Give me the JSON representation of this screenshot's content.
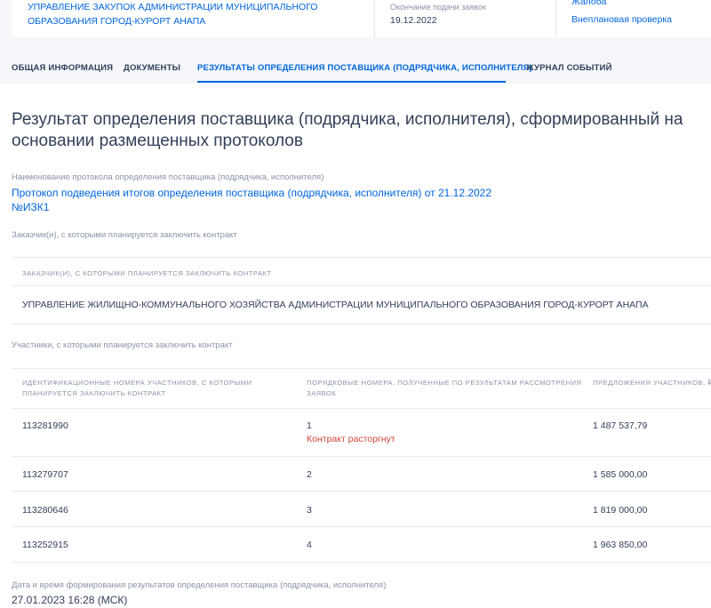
{
  "top": {
    "organizer": "УПРАВЛЕНИЕ ЗАКУПОК АДМИНИСТРАЦИИ МУНИЦИПАЛЬНОГО ОБРАЗОВАНИЯ ГОРОД-КУРОРТ АНАПА",
    "deadline_label": "Окончание подачи заявок",
    "deadline_value": "19.12.2022",
    "link1": "Жалоба",
    "link2": "Внеплановая проверка"
  },
  "tabs": [
    {
      "label": "ОБЩАЯ ИНФОРМАЦИЯ",
      "active": false
    },
    {
      "label": "ДОКУМЕНТЫ",
      "active": false
    },
    {
      "label": "РЕЗУЛЬТАТЫ ОПРЕДЕЛЕНИЯ ПОСТАВЩИКА (ПОДРЯДЧИКА, ИСПОЛНИТЕЛЯ)",
      "active": true
    },
    {
      "label": "ЖУРНАЛ СОБЫТИЙ",
      "active": false
    }
  ],
  "main": {
    "title": "Результат определения поставщика (подрядчика, исполнителя), сформированный на основании размещенных протоколов",
    "protocol_label": "Наименование протокола определения поставщика (подрядчика, исполнителя)",
    "protocol_link": "Протокол подведения итогов определения поставщика (подрядчика, исполнителя) от 21.12.2022 №ИЗК1",
    "customers_label": "Заказчик(и), с которыми планируется заключить контракт",
    "customers_table": {
      "header": "Заказчик(и), с которыми планируется заключить контракт",
      "row": "УПРАВЛЕНИЕ ЖИЛИЩНО-КОММУНАЛЬНОГО ХОЗЯЙСТВА АДМИНИСТРАЦИИ МУНИЦИПАЛЬНОГО ОБРАЗОВАНИЯ ГОРОД-КУРОРТ АНАПА"
    },
    "participants_label": "Участники, с которыми планируется заключить контракт",
    "participants_table": {
      "headers": [
        "Идентификационные номера участников, с которыми планируется заключить контракт",
        "Порядковые номера, полученные по результатам рассмотрения заявок",
        "Предложения участников, ₽"
      ],
      "rows": [
        {
          "id": "113281990",
          "rank": "1",
          "note": "Контракт расторгнут",
          "offer": "1 487 537,79"
        },
        {
          "id": "113279707",
          "rank": "2",
          "note": "",
          "offer": "1 585 000,00"
        },
        {
          "id": "113280646",
          "rank": "3",
          "note": "",
          "offer": "1 819 000,00"
        },
        {
          "id": "113252915",
          "rank": "4",
          "note": "",
          "offer": "1 963 850,00"
        }
      ]
    },
    "datetime_label": "Дата и время формирования результатов определения поставщика (подрядчика, исполнителя)",
    "datetime_value": "27.01.2023 16:28 (МСК)"
  },
  "colors": {
    "accent": "#0065dd",
    "danger": "#d0453d",
    "text": "#334059",
    "muted": "#8a94a6"
  }
}
